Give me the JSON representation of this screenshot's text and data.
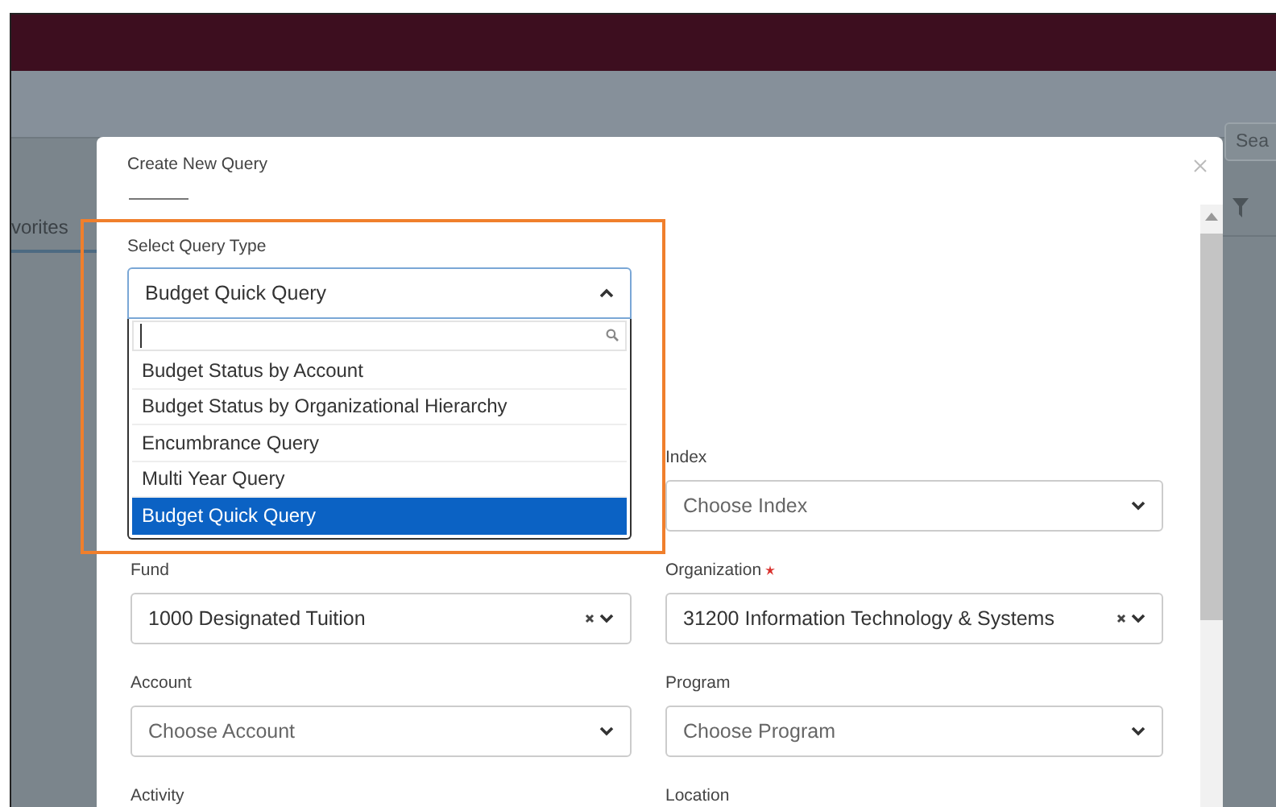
{
  "background": {
    "tab_label": "vorites",
    "search_placeholder": "Sea"
  },
  "dialog": {
    "title": "Create New Query",
    "query_type": {
      "label": "Select Query Type",
      "value": "Budget Quick Query",
      "expanded": true,
      "options": [
        {
          "label": "Budget Status by Account",
          "selected": false
        },
        {
          "label": "Budget Status by Organizational Hierarchy",
          "selected": false
        },
        {
          "label": "Encumbrance Query",
          "selected": false
        },
        {
          "label": "Multi Year Query",
          "selected": false
        },
        {
          "label": "Budget Quick Query",
          "selected": true
        }
      ]
    },
    "rows": [
      {
        "right": {
          "label": "Index",
          "placeholder": "Choose Index",
          "required": false,
          "clearable": false
        }
      },
      {
        "left": {
          "label": "Fund",
          "value": "1000 Designated Tuition",
          "required": false,
          "clearable": true
        },
        "right": {
          "label": "Organization",
          "value": "31200 Information Technology & Systems",
          "required": true,
          "clearable": true
        }
      },
      {
        "left": {
          "label": "Account",
          "placeholder": "Choose Account",
          "required": false,
          "clearable": false
        },
        "right": {
          "label": "Program",
          "placeholder": "Choose Program",
          "required": false,
          "clearable": false
        }
      },
      {
        "left": {
          "label": "Activity",
          "required": false
        },
        "right": {
          "label": "Location",
          "required": false
        }
      }
    ]
  }
}
